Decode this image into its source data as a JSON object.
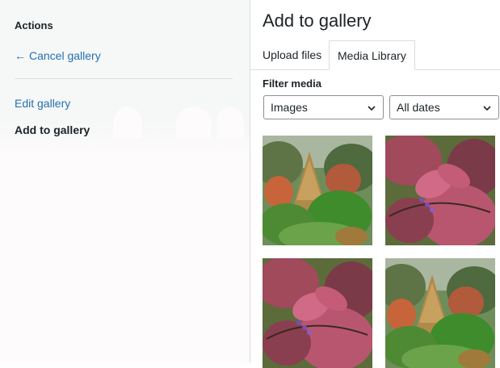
{
  "sidebar": {
    "actions_title": "Actions",
    "cancel_label": "Cancel gallery",
    "edit_label": "Edit gallery",
    "add_label": "Add to gallery"
  },
  "panel": {
    "title": "Add to gallery",
    "tabs": [
      {
        "label": "Upload files"
      },
      {
        "label": "Media Library",
        "active": true
      }
    ],
    "filter_label": "Filter media",
    "type_select": "Images",
    "date_select": "All dates"
  },
  "thumbnails": [
    {
      "subject": "conifer garden"
    },
    {
      "subject": "pink leaves"
    },
    {
      "subject": "pink leaves"
    },
    {
      "subject": "conifer garden"
    }
  ],
  "colors": {
    "link": "#2271b1",
    "text": "#1d2327",
    "border": "#dcdcde"
  }
}
